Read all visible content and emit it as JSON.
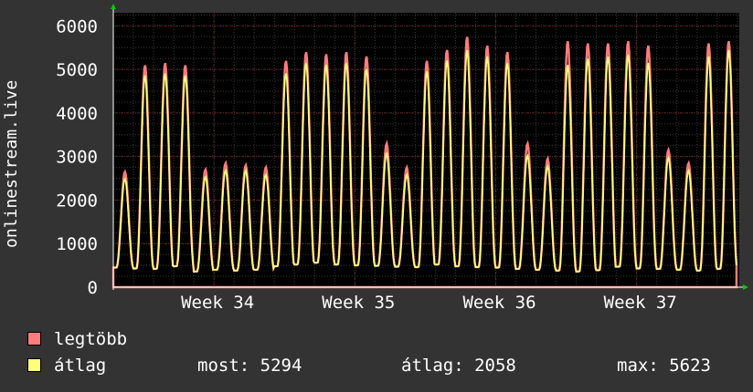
{
  "chart_data": {
    "type": "area",
    "ylabel": "onlinestream.live",
    "ylim": [
      0,
      6300
    ],
    "yticks": [
      0,
      1000,
      2000,
      3000,
      4000,
      5000,
      6000
    ],
    "xticks": [
      {
        "label": "Week 34",
        "x": 5
      },
      {
        "label": "Week 35",
        "x": 12
      },
      {
        "label": "Week 36",
        "x": 19
      },
      {
        "label": "Week 37",
        "x": 26
      }
    ],
    "xlim": [
      0,
      31.1
    ],
    "grid": true,
    "daily_peaks_max": [
      2650,
      5100,
      5150,
      5100,
      2700,
      2850,
      2800,
      2750,
      5200,
      5400,
      5350,
      5400,
      5300,
      3300,
      2750,
      5200,
      5450,
      5750,
      5550,
      5400,
      3300,
      2950,
      5650,
      5600,
      5600,
      5650,
      5550,
      3150,
      2850,
      5600,
      5650
    ],
    "daily_peaks_avg": [
      2550,
      5000,
      5050,
      5000,
      2600,
      2750,
      2750,
      2650,
      5050,
      5300,
      5250,
      5300,
      5150,
      3150,
      2650,
      5100,
      5350,
      5600,
      5450,
      5300,
      3100,
      2850,
      5250,
      5400,
      5450,
      5500,
      5300,
      3050,
      2750,
      5450,
      5600
    ],
    "daily_troughs": [
      450,
      430,
      420,
      480,
      360,
      400,
      380,
      400,
      480,
      520,
      560,
      520,
      500,
      490,
      470,
      460,
      520,
      480,
      460,
      450,
      420,
      400,
      380,
      360,
      390,
      470,
      430,
      420,
      400,
      380,
      420
    ],
    "series": [
      {
        "name": "legtöbb",
        "color": "#ff7c7c"
      },
      {
        "name": "átlag",
        "color": "#ffff7c"
      }
    ]
  },
  "legend": {
    "max_label": "legtöbb",
    "avg_label": "átlag"
  },
  "stats": {
    "now": "most: 5294",
    "avg": "átlag: 2058",
    "max": "max: 5623"
  }
}
